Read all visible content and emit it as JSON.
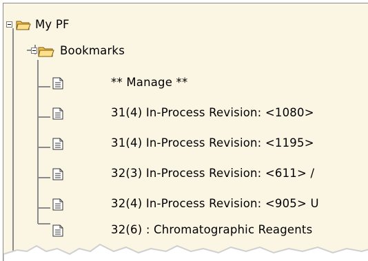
{
  "tree": {
    "root": {
      "label": "My PF",
      "icon": "open-folder-icon",
      "expanded": true
    },
    "folder": {
      "label": "Bookmarks",
      "icon": "open-folder-icon",
      "expanded": true
    },
    "items": [
      {
        "label": "** Manage **",
        "icon": "document-icon"
      },
      {
        "label": "31(4) In-Process Revision: <1080>",
        "icon": "document-icon"
      },
      {
        "label": "31(4) In-Process Revision: <1195>",
        "icon": "document-icon"
      },
      {
        "label": "32(3) In-Process Revision: <611> /",
        "icon": "document-icon"
      },
      {
        "label": "32(4) In-Process Revision: <905> U",
        "icon": "document-icon"
      },
      {
        "label": "32(6) : Chromatographic Reagents",
        "icon": "document-icon"
      }
    ]
  },
  "colors": {
    "panel_bg": "#fbf5e3",
    "tree_line": "#8a8a8a",
    "folder": "#f2c14e"
  }
}
